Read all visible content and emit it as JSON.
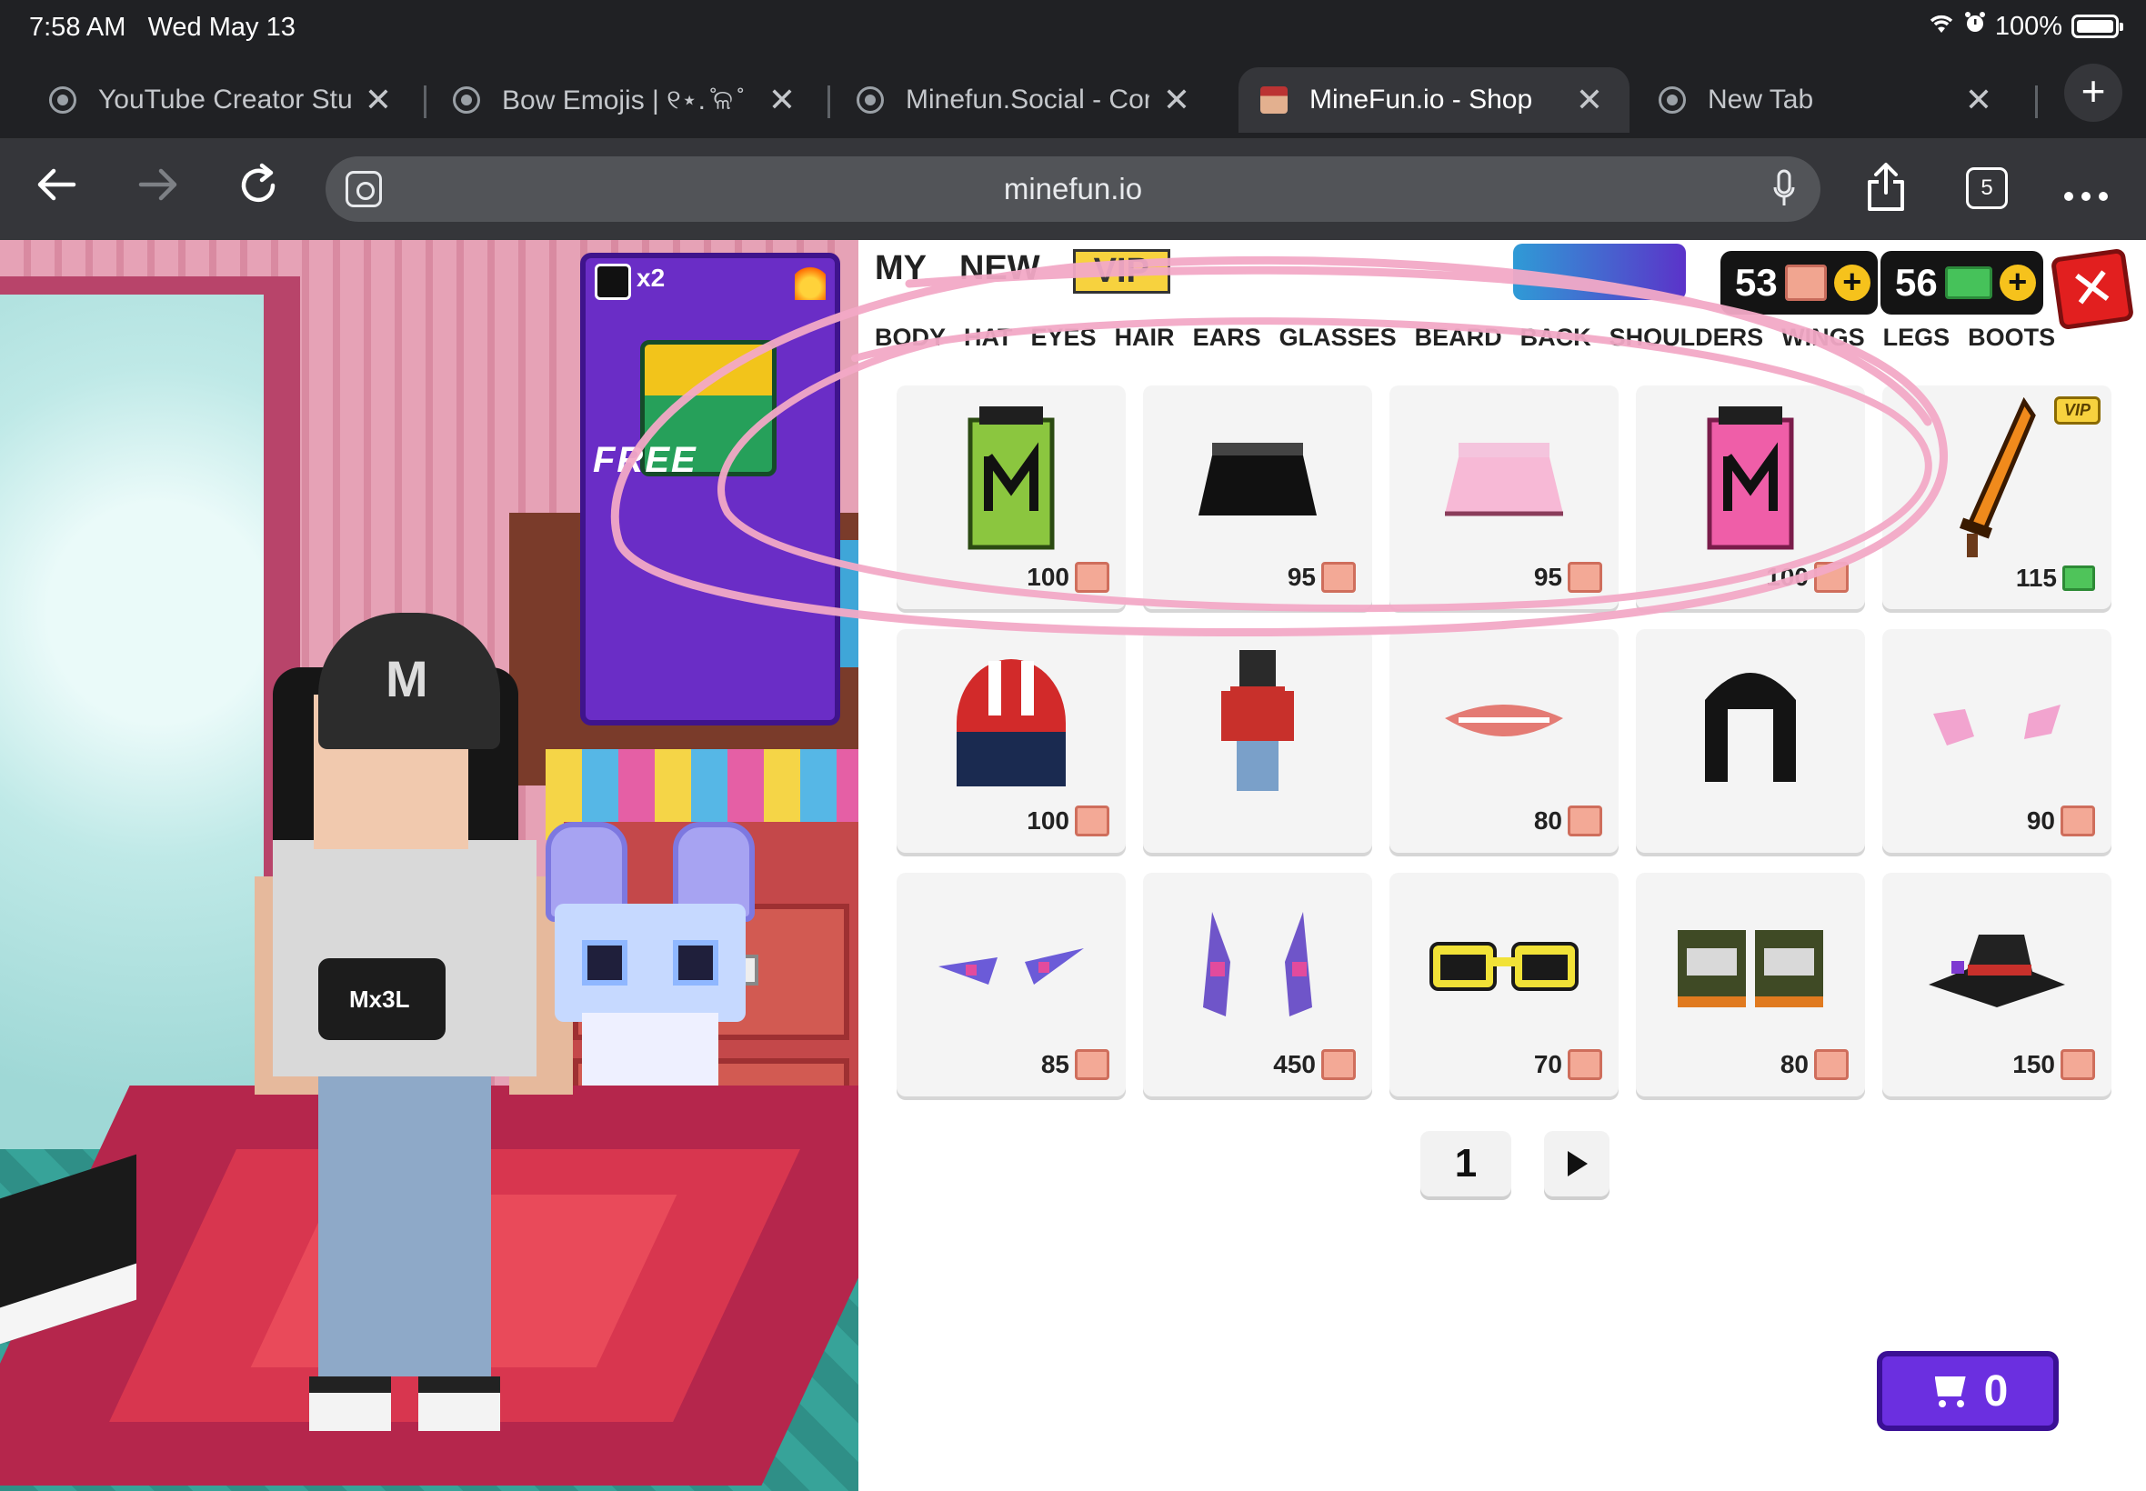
{
  "status_bar": {
    "time": "7:58 AM",
    "date": "Wed May 13",
    "battery": "100%"
  },
  "tabs": [
    {
      "title": "YouTube Creator Stud",
      "active": false
    },
    {
      "title": "Bow Emojis | ୧⋆.  ̊ଳ ̊",
      "active": false
    },
    {
      "title": "Minefun.Social - Conn",
      "active": false
    },
    {
      "title": "MineFun.io - Shop",
      "active": true
    },
    {
      "title": "New Tab",
      "active": false
    }
  ],
  "toolbar": {
    "url": "minefun.io",
    "tab_count": "5"
  },
  "game_view": {
    "promo_multiplier": "x2",
    "promo_label": "FREE",
    "cap_letter": "M",
    "bag_text": "Mx3L"
  },
  "shop": {
    "categories": [
      "MY",
      "NEW",
      "VIP"
    ],
    "slots": [
      "BODY",
      "HAT",
      "EYES",
      "HAIR",
      "EARS",
      "GLASSES",
      "BEARD",
      "BACK",
      "SHOULDERS",
      "WINGS",
      "LEGS",
      "BOOTS"
    ],
    "boxes": "53",
    "cash": "56",
    "items": [
      {
        "name": "green-m-top",
        "price": "100",
        "currency": "box"
      },
      {
        "name": "black-skirt",
        "price": "95",
        "currency": "box"
      },
      {
        "name": "pink-skirt",
        "price": "95",
        "currency": "box"
      },
      {
        "name": "pink-m-top",
        "price": "100",
        "currency": "box"
      },
      {
        "name": "flame-sword",
        "price": "115",
        "currency": "cash",
        "vip": "VIP"
      },
      {
        "name": "racing-helmet",
        "price": "100",
        "currency": "box"
      },
      {
        "name": "red-jacket-outfit",
        "price": "",
        "currency": ""
      },
      {
        "name": "lips",
        "price": "80",
        "currency": "box"
      },
      {
        "name": "black-curly-hair",
        "price": "",
        "currency": ""
      },
      {
        "name": "pink-cheeks",
        "price": "90",
        "currency": "box"
      },
      {
        "name": "purple-eyes",
        "price": "85",
        "currency": "box"
      },
      {
        "name": "crystal-shoulders",
        "price": "450",
        "currency": "box"
      },
      {
        "name": "yellow-sunglasses",
        "price": "70",
        "currency": "box"
      },
      {
        "name": "camo-boots",
        "price": "80",
        "currency": "box"
      },
      {
        "name": "witch-hat",
        "price": "150",
        "currency": "box"
      }
    ],
    "page": "1",
    "cart_count": "0"
  },
  "colors": {
    "browser_bg": "#202124",
    "toolbar_bg": "#35363a",
    "cart_purple": "#6b2fe0",
    "annotation_pink": "#f2a9c6",
    "close_red": "#e21f1f"
  }
}
